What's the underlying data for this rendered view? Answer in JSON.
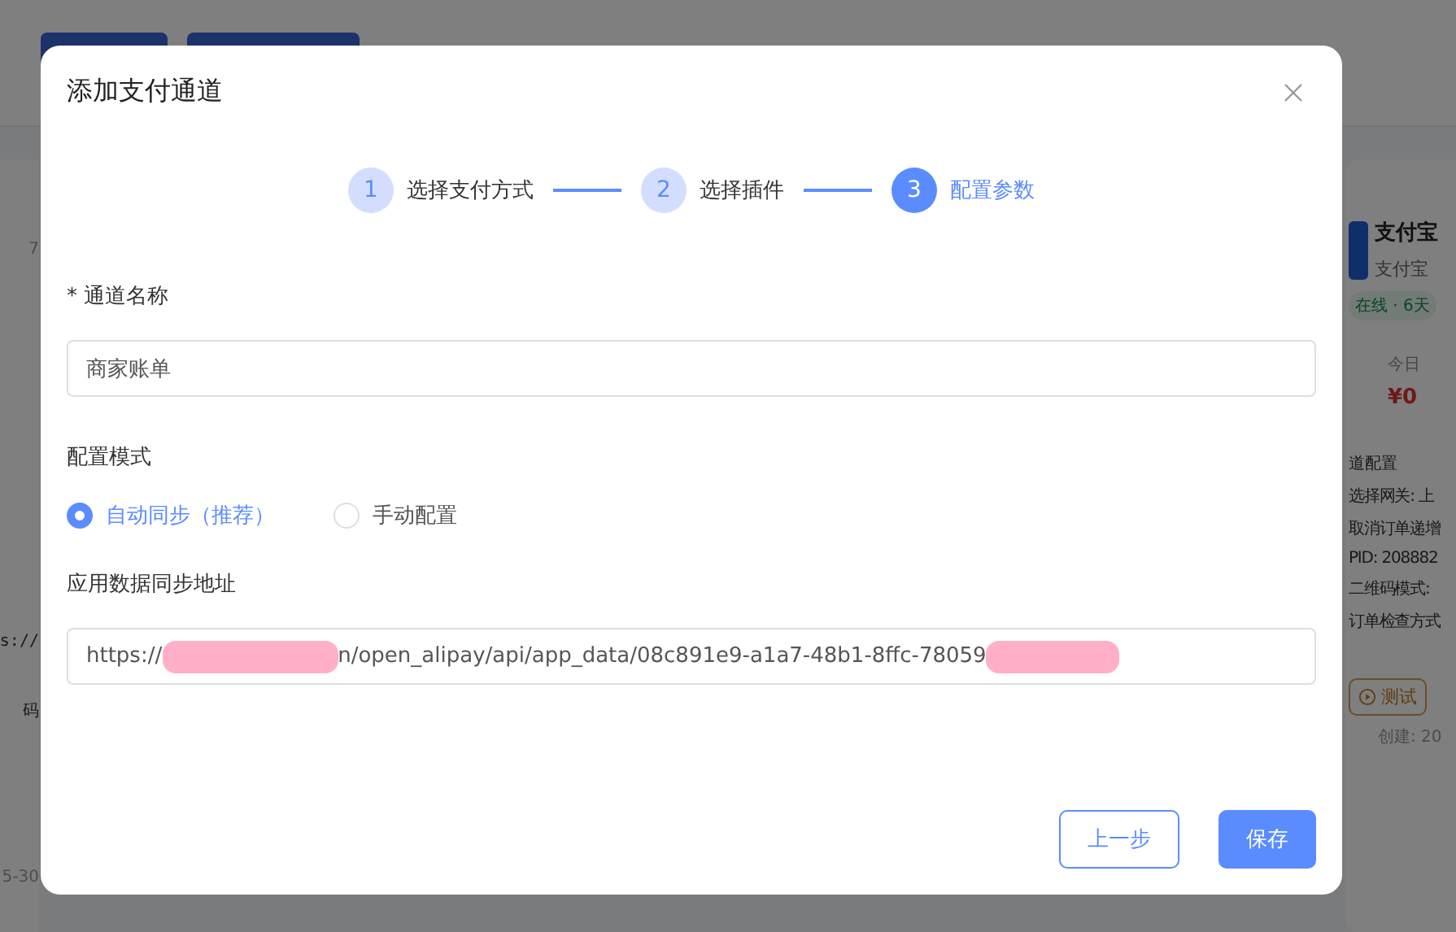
{
  "background": {
    "left_card": {
      "lines": [
        {
          "kind": "muted",
          "text": "7"
        },
        {
          "kind": "mono",
          "text": "s://"
        },
        {
          "kind": "plain",
          "text": "码"
        },
        {
          "kind": "muted",
          "text": "5-30"
        }
      ]
    },
    "right_card": {
      "title": "支付宝",
      "subtitle": "支付宝",
      "status": "在线 · 6天",
      "stat_label": "今日",
      "stat_value": "¥0",
      "section": "道配置",
      "config_lines": [
        "选择网关: 上",
        "取消订单递增",
        "PID: 208882",
        "二维码模式:",
        "订单检查方式"
      ],
      "test_button": "测试",
      "created": "创建: 20"
    }
  },
  "dialog": {
    "title": "添加支付通道",
    "steps": [
      {
        "number": "1",
        "label": "选择支付方式",
        "selected": false
      },
      {
        "number": "2",
        "label": "选择插件",
        "selected": false
      },
      {
        "number": "3",
        "label": "配置参数",
        "selected": true
      }
    ],
    "fields": [
      {
        "kind": "text",
        "label": "通道名称",
        "required_mark": "*",
        "value": "商家账单"
      },
      {
        "kind": "radio",
        "label": "配置模式",
        "options": [
          {
            "label": "自动同步（推荐）",
            "selected": true
          },
          {
            "label": "手动配置",
            "selected": false
          }
        ]
      },
      {
        "kind": "url",
        "label": "应用数据同步地址",
        "segments": [
          {
            "kind": "text",
            "text": "https://"
          },
          {
            "kind": "redacted"
          },
          {
            "kind": "text",
            "text": "n/open_alipay/api/app_data/08c891e9-a1a7-48b1-8ffc-78059"
          },
          {
            "kind": "redacted"
          }
        ]
      }
    ],
    "buttons": [
      {
        "kind": "secondary",
        "label": "上一步"
      },
      {
        "kind": "primary",
        "label": "保存"
      }
    ]
  }
}
